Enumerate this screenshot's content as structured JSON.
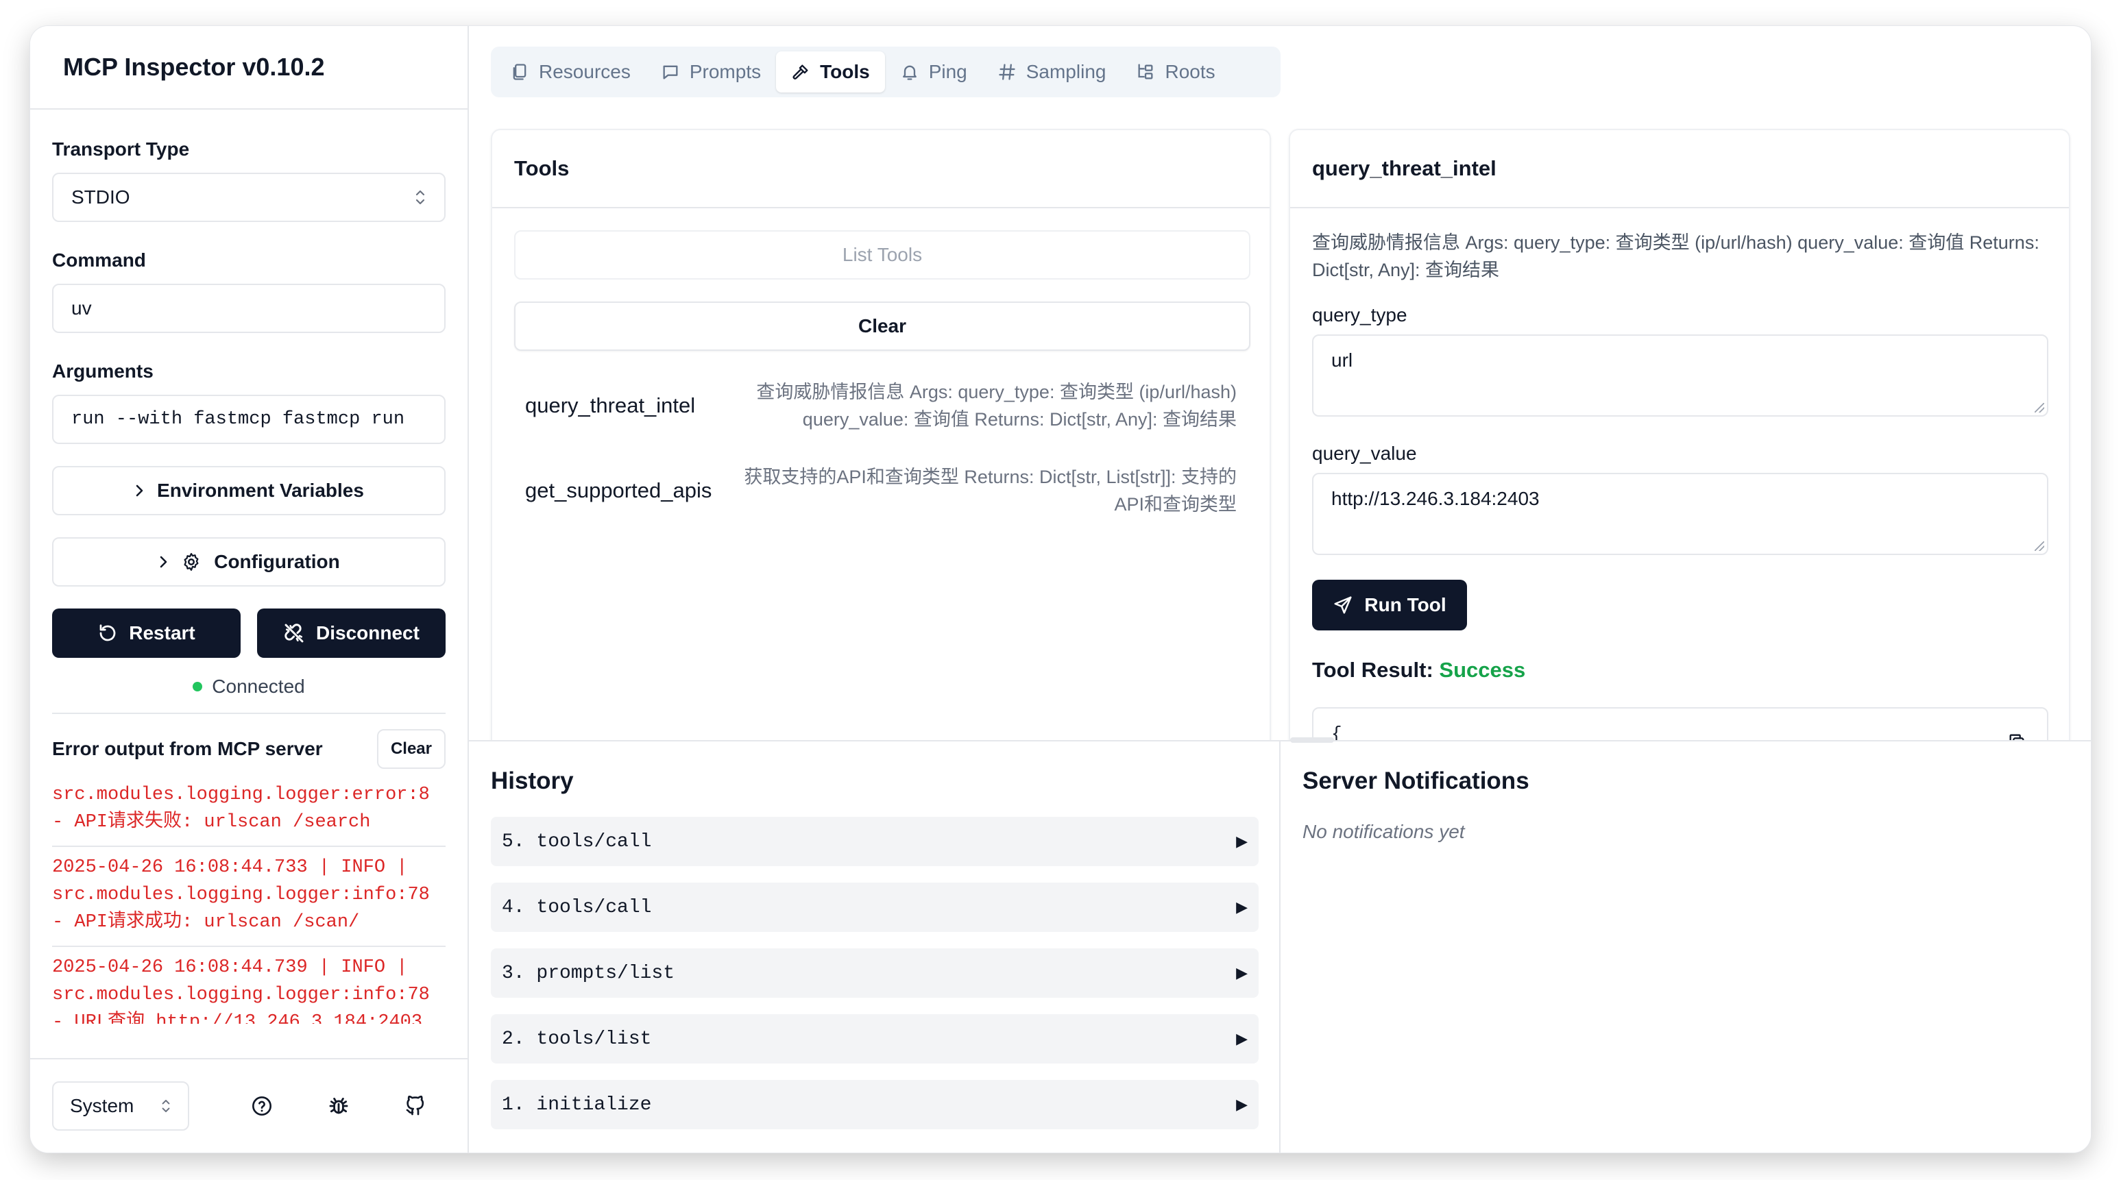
{
  "app": {
    "title": "MCP Inspector v0.10.2"
  },
  "sidebar": {
    "transport_label": "Transport Type",
    "transport_value": "STDIO",
    "command_label": "Command",
    "command_value": "uv",
    "arguments_label": "Arguments",
    "arguments_value": "run --with fastmcp fastmcp run",
    "env_button": "Environment Variables",
    "config_button": "Configuration",
    "restart_button": "Restart",
    "disconnect_button": "Disconnect",
    "status": "Connected",
    "status_color": "#22c55e",
    "error_title": "Error output from MCP server",
    "error_clear": "Clear",
    "error_logs": [
      "src.modules.logging.logger:error:8\n- API请求失败: urlscan /search",
      "2025-04-26 16:08:44.733 | INFO |\nsrc.modules.logging.logger:info:78\n- API请求成功: urlscan /scan/",
      "2025-04-26 16:08:44.739 | INFO |\nsrc.modules.logging.logger:info:78\n- URL查询 http://13.246.3.184:2403"
    ],
    "theme_value": "System"
  },
  "tabs": [
    {
      "label": "Resources",
      "icon": "files-icon"
    },
    {
      "label": "Prompts",
      "icon": "message-square-icon"
    },
    {
      "label": "Tools",
      "icon": "hammer-icon"
    },
    {
      "label": "Ping",
      "icon": "bell-icon"
    },
    {
      "label": "Sampling",
      "icon": "hash-icon"
    },
    {
      "label": "Roots",
      "icon": "folder-tree-icon"
    }
  ],
  "tools_panel": {
    "title": "Tools",
    "list_button": "List Tools",
    "clear_button": "Clear",
    "tools": [
      {
        "name": "query_threat_intel",
        "desc": "查询威胁情报信息 Args: query_type: 查询类型 (ip/url/hash) query_value: 查询值 Returns: Dict[str, Any]: 查询结果"
      },
      {
        "name": "get_supported_apis",
        "desc": "获取支持的API和查询类型 Returns: Dict[str, List[str]]: 支持的API和查询类型"
      }
    ]
  },
  "tool_detail": {
    "title": "query_threat_intel",
    "description": "查询威胁情报信息 Args: query_type: 查询类型 (ip/url/hash) query_value: 查询值 Returns: Dict[str, Any]: 查询结果",
    "param1_label": "query_type",
    "param1_value": "url",
    "param2_label": "query_value",
    "param2_value": "http://13.246.3.184:2403",
    "run_button": "Run Tool",
    "result_label": "Tool Result:",
    "result_status": "Success",
    "result_status_color": "#16a34a",
    "result_preview": "{"
  },
  "history": {
    "title": "History",
    "items": [
      "5. tools/call",
      "4. tools/call",
      "3. prompts/list",
      "2. tools/list",
      "1. initialize"
    ]
  },
  "notifications": {
    "title": "Server Notifications",
    "empty": "No notifications yet"
  }
}
